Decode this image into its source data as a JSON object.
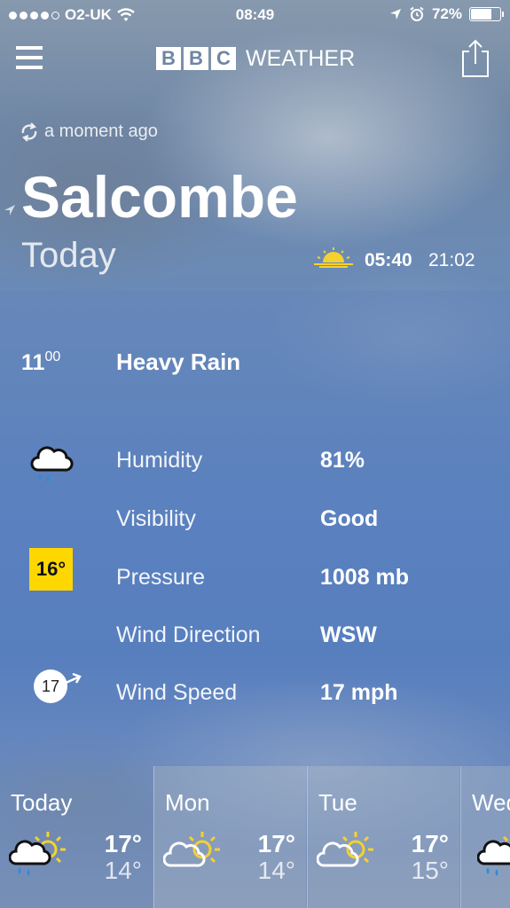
{
  "status_bar": {
    "carrier": "O2-UK",
    "time": "08:49",
    "battery": "72%",
    "battery_level": 0.72
  },
  "header": {
    "logo_letters": [
      "B",
      "B",
      "C"
    ],
    "logo_word": "WEATHER",
    "menu_icon": "hamburger-icon",
    "share_icon": "share-icon"
  },
  "location": {
    "updated": "a moment ago",
    "city": "Salcombe",
    "day": "Today",
    "sunrise": "05:40",
    "sunset": "21:02"
  },
  "detail": {
    "hour": "11",
    "minutes": "00",
    "condition": "Heavy Rain",
    "temperature": "16°",
    "wind_speed_badge": "17",
    "rows": [
      {
        "label": "Humidity",
        "value": "81%"
      },
      {
        "label": "Visibility",
        "value": "Good"
      },
      {
        "label": "Pressure",
        "value": "1008 mb"
      },
      {
        "label": "Wind Direction",
        "value": "WSW"
      },
      {
        "label": "Wind Speed",
        "value": "17 mph"
      }
    ]
  },
  "forecast": [
    {
      "day": "Today",
      "high": "17°",
      "low": "14°",
      "icon": "rain-sun-icon"
    },
    {
      "day": "Mon",
      "high": "17°",
      "low": "14°",
      "icon": "cloud-sun-icon"
    },
    {
      "day": "Tue",
      "high": "17°",
      "low": "15°",
      "icon": "cloud-sun-icon"
    },
    {
      "day": "Wed",
      "high": "",
      "low": "",
      "icon": "rain-sun-icon"
    }
  ],
  "colors": {
    "temperature_badge": "#ffd700",
    "sun_icon": "#f5d130"
  }
}
